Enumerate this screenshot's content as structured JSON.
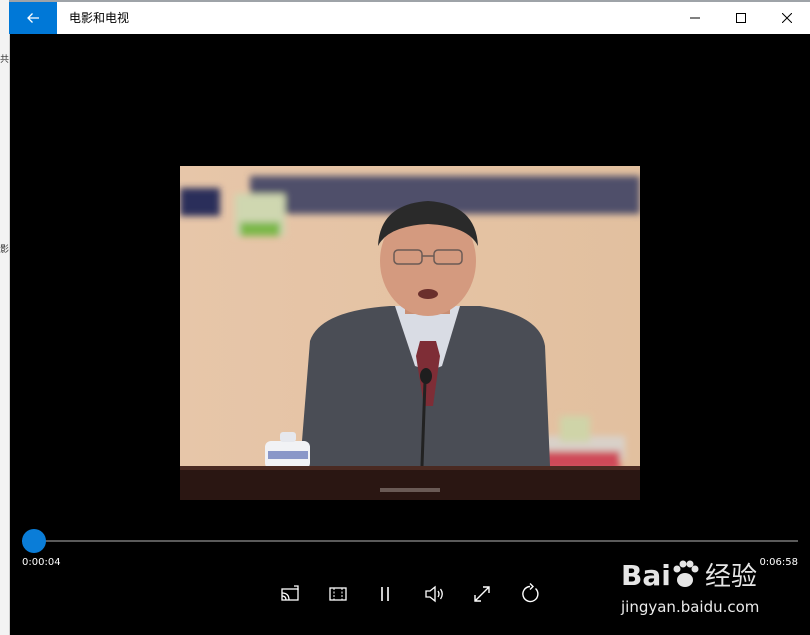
{
  "window": {
    "title": "电影和电视"
  },
  "left_strip": {
    "marks": [
      "共",
      "影"
    ]
  },
  "playback": {
    "current_time": "0:00:04",
    "duration": "0:06:58",
    "progress": 0.01
  },
  "colors": {
    "accent": "#0078d7",
    "background": "#000000"
  },
  "controls": [
    {
      "name": "cast-to-device-icon"
    },
    {
      "name": "aspect-ratio-icon"
    },
    {
      "name": "pause-icon"
    },
    {
      "name": "volume-icon"
    },
    {
      "name": "fullscreen-icon"
    },
    {
      "name": "repeat-icon"
    }
  ],
  "watermark": {
    "text": "jingyan.baidu.com",
    "logo_text": "Bai  经验"
  }
}
